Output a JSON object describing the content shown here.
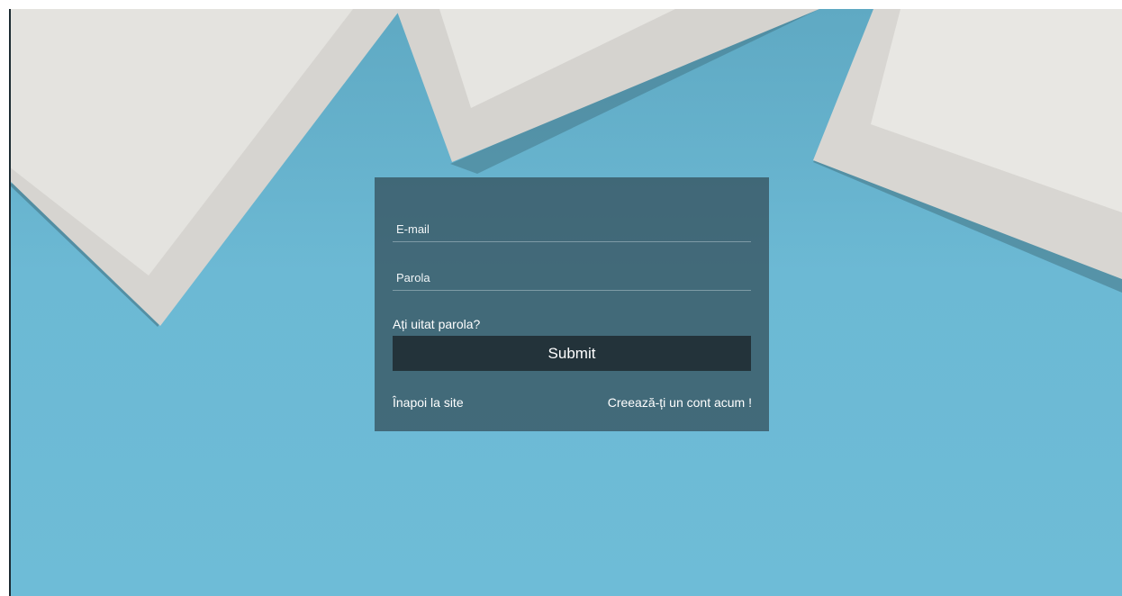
{
  "login": {
    "email_placeholder": "E-mail",
    "password_placeholder": "Parola",
    "forgot_password": "Ați uitat parola?",
    "submit_label": "Submit",
    "back_to_site": "Înapoi la site",
    "create_account": "Creează-ți un cont acum !"
  },
  "colors": {
    "background": "#6ebcd7",
    "panel": "#324b56",
    "button": "#23333a",
    "paper": "#e7e6e2"
  }
}
